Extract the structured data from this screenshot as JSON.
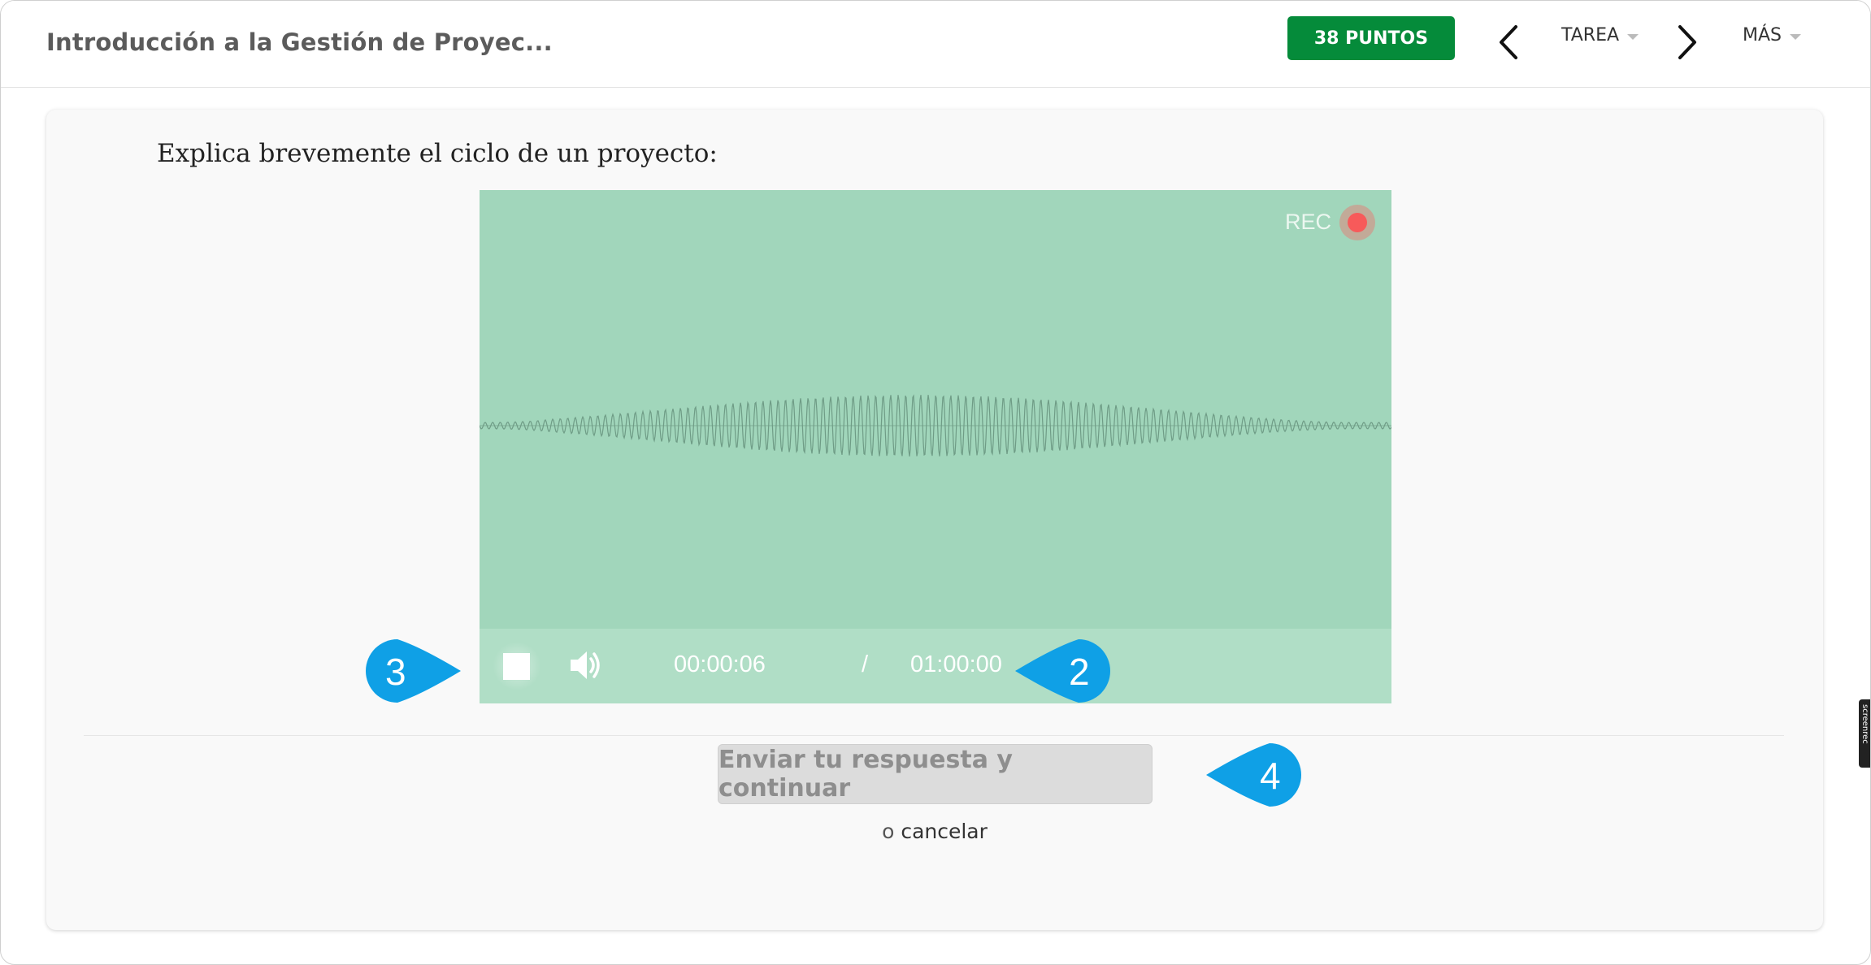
{
  "header": {
    "course_title": "Introducción a la Gestión de Proyec...",
    "points_label": "38 PUNTOS",
    "tarea_label": "TAREA",
    "mas_label": "MÁS"
  },
  "question": {
    "text": "Explica brevemente el ciclo de un proyecto:"
  },
  "recorder": {
    "rec_label": "REC",
    "current_time": "00:00:06",
    "separator": "/",
    "total_time": "01:00:00"
  },
  "callouts": {
    "stop": "3",
    "time": "2",
    "submit": "4"
  },
  "actions": {
    "submit_label": "Enviar tu respuesta y continuar",
    "or_text": "o",
    "cancel_label": "cancelar"
  },
  "overlay": {
    "screenrec_label": "screenrec"
  },
  "colors": {
    "badge_green": "#058b3a",
    "recorder_bg": "#a1d6bb",
    "callout_blue": "#0fa0e6",
    "rec_red": "#f75a5a"
  }
}
